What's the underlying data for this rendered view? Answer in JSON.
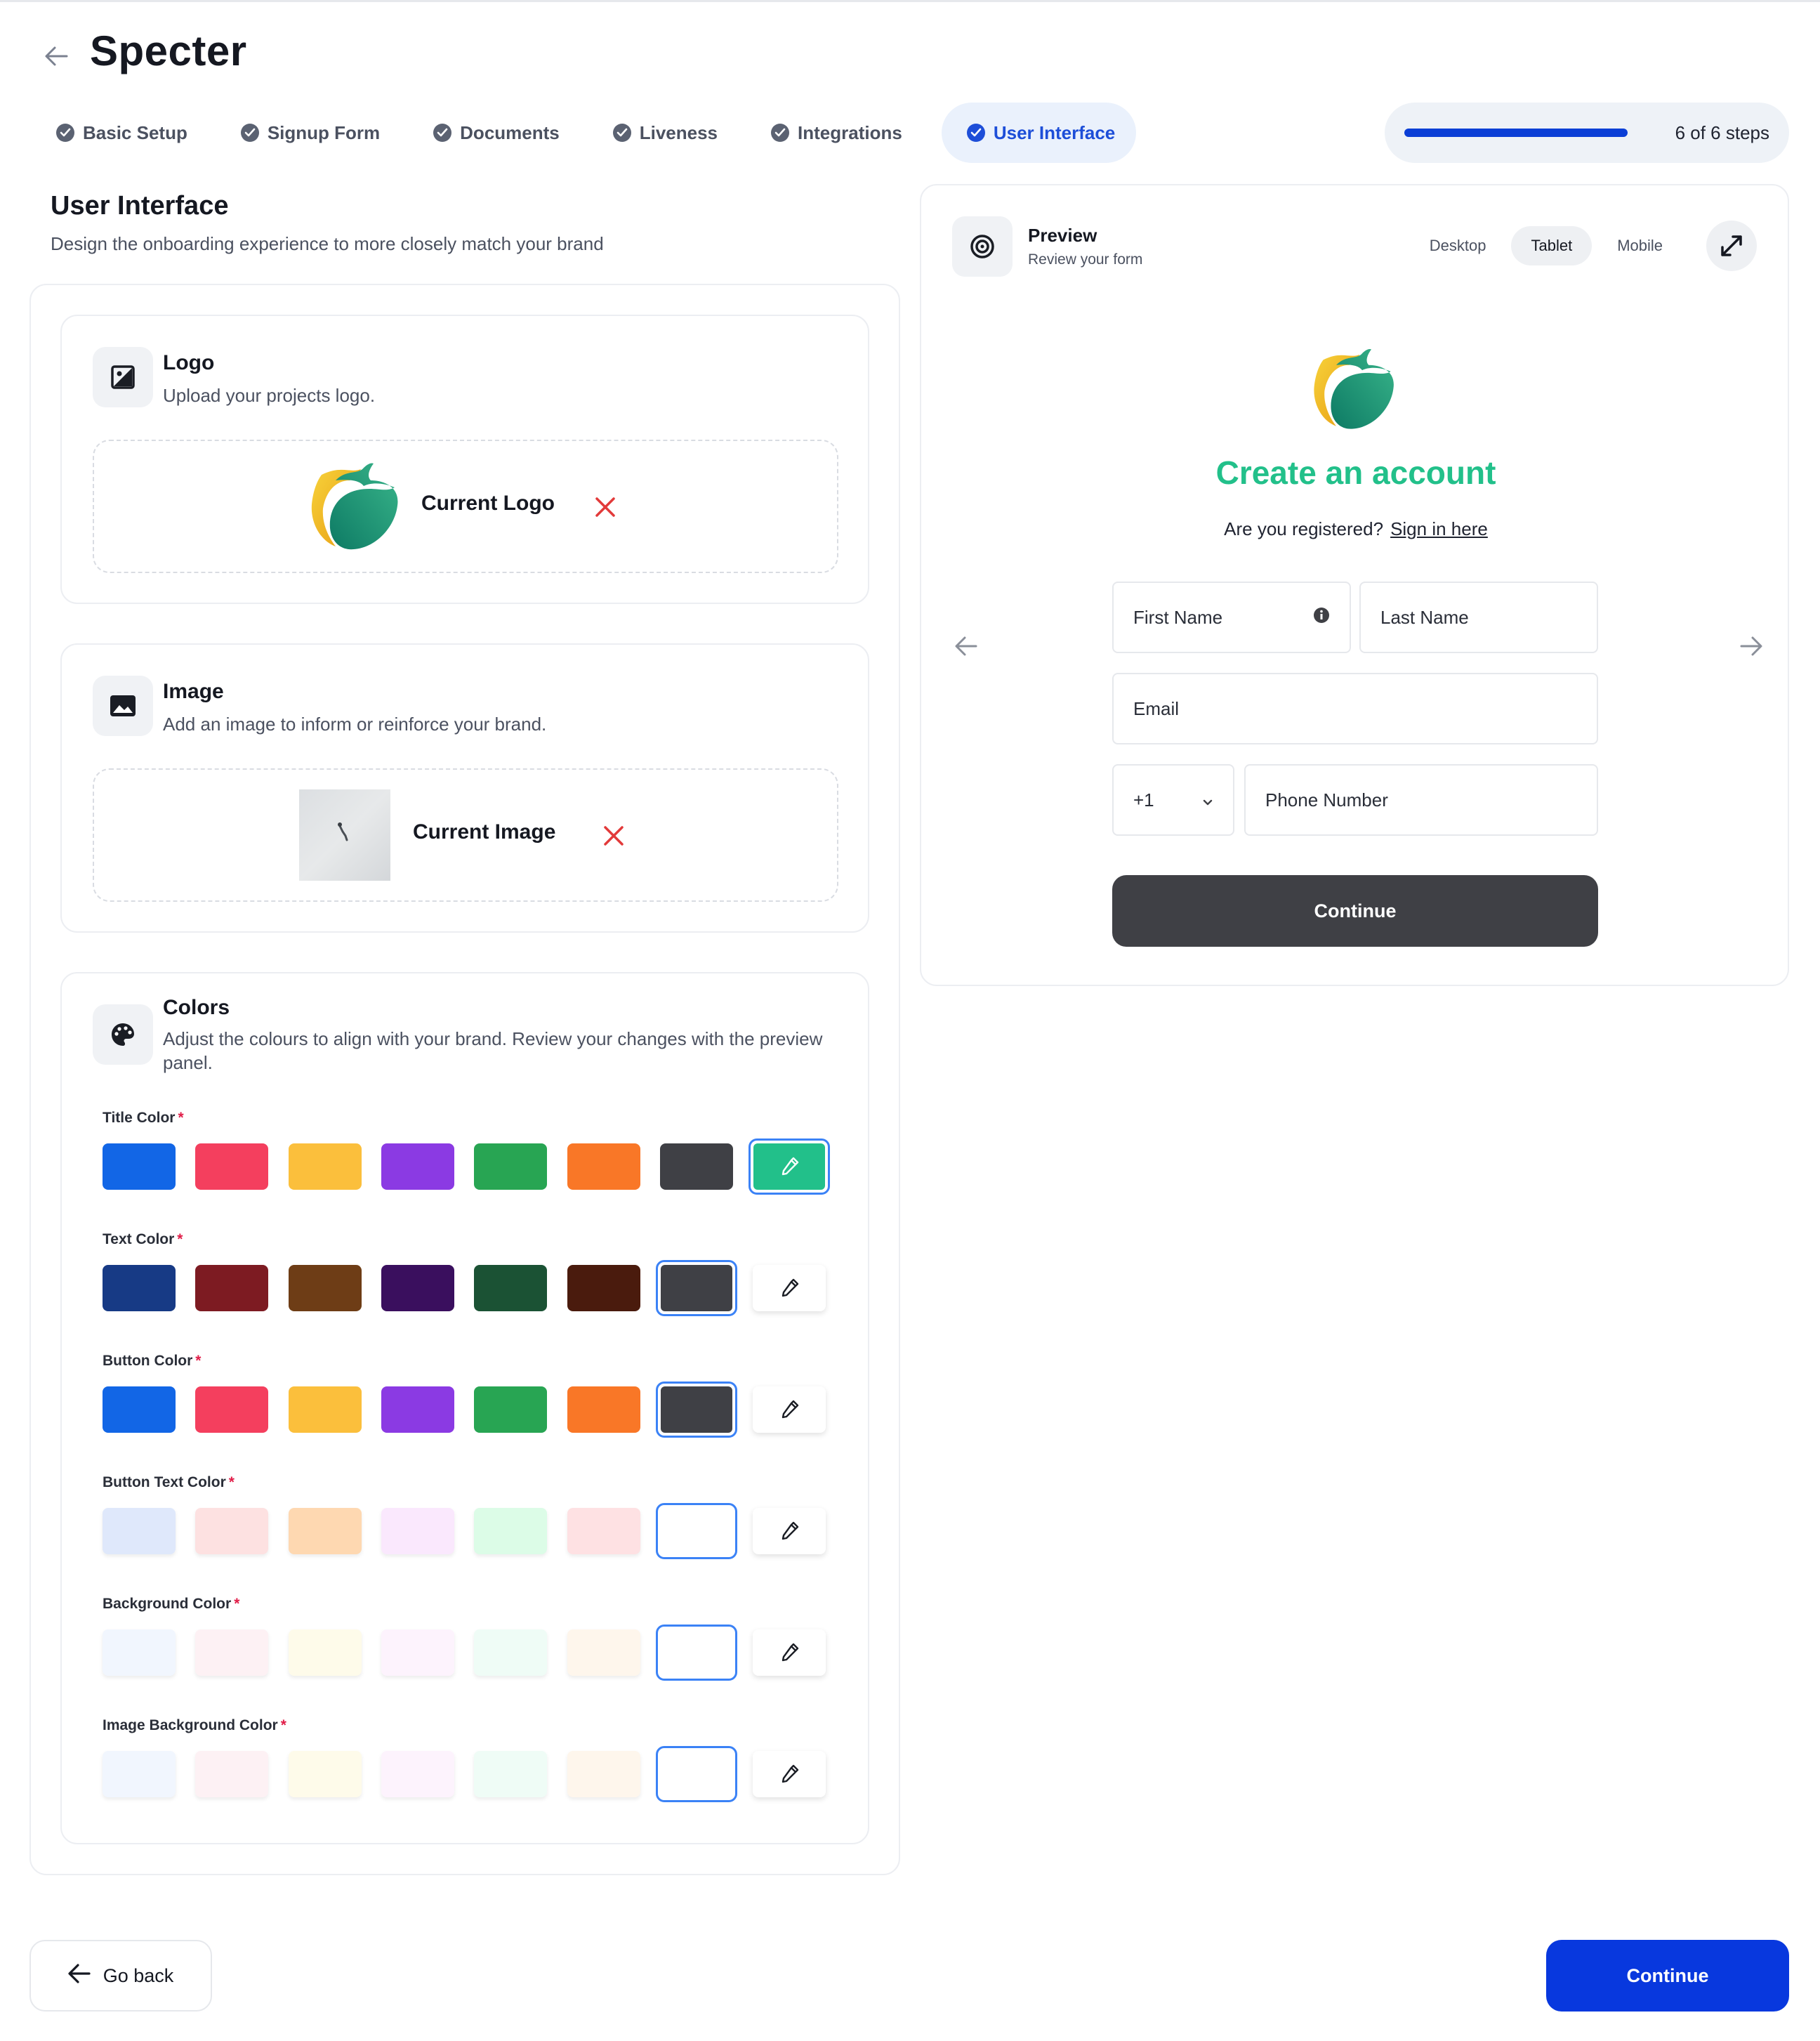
{
  "app": {
    "title": "Specter"
  },
  "steps": [
    {
      "label": "Basic Setup",
      "done": true
    },
    {
      "label": "Signup Form",
      "done": true
    },
    {
      "label": "Documents",
      "done": true
    },
    {
      "label": "Liveness",
      "done": true
    },
    {
      "label": "Integrations",
      "done": true
    },
    {
      "label": "User Interface",
      "done": true,
      "active": true
    }
  ],
  "progress": {
    "text": "6 of 6 steps",
    "fraction": 1.0,
    "color": "#0b3fd6"
  },
  "section": {
    "title": "User Interface",
    "subtitle": "Design the onboarding experience to more closely match your brand"
  },
  "logo_card": {
    "title": "Logo",
    "subtitle": "Upload your projects logo.",
    "current_label": "Current Logo"
  },
  "image_card": {
    "title": "Image",
    "subtitle": "Add an image to inform or reinforce your brand.",
    "current_label": "Current Image"
  },
  "colors_card": {
    "title": "Colors",
    "subtitle": "Adjust the colours to align with your brand. Review your changes with the preview panel.",
    "groups": [
      {
        "label": "Title Color",
        "swatches": [
          "#1266e6",
          "#f43f5e",
          "#fbbf3c",
          "#8b3ae3",
          "#28a553",
          "#f97727",
          "#3f4045"
        ],
        "selected": "picker",
        "picker_color": "#22c08a"
      },
      {
        "label": "Text Color",
        "swatches": [
          "#173a85",
          "#7d1b22",
          "#6e3d16",
          "#3a0f5e",
          "#1b5234",
          "#4a1b0d",
          "#3f4045"
        ],
        "selected": 6
      },
      {
        "label": "Button Color",
        "swatches": [
          "#1266e6",
          "#f43f5e",
          "#fbbf3c",
          "#8b3ae3",
          "#28a553",
          "#f97727",
          "#3f4045"
        ],
        "selected": 6
      },
      {
        "label": "Button Text Color",
        "swatches": [
          "#dfe8fb",
          "#fde1e1",
          "#fed8b1",
          "#fae8fd",
          "#dcfce7",
          "#fee1e3",
          "#ffffff"
        ],
        "selected": 6
      },
      {
        "label": "Background Color",
        "swatches": [
          "#f1f6fe",
          "#fdf1f4",
          "#fefbea",
          "#fdf3fd",
          "#effcf6",
          "#fef6ec",
          "#ffffff"
        ],
        "selected": 6
      },
      {
        "label": "Image Background Color",
        "swatches": [
          "#f1f6fe",
          "#fdf1f4",
          "#fefbea",
          "#fdf3fd",
          "#effcf6",
          "#fef6ec",
          "#ffffff"
        ],
        "selected": 6
      }
    ],
    "required_mark": "*"
  },
  "preview": {
    "title": "Preview",
    "subtitle": "Review your form",
    "device_tabs": [
      "Desktop",
      "Tablet",
      "Mobile"
    ],
    "active_device": "Tablet",
    "form": {
      "heading": "Create an account",
      "heading_color": "#22c08a",
      "question": "Are you registered?",
      "sign_in_link": "Sign in here",
      "first_name_placeholder": "First Name",
      "last_name_placeholder": "Last Name",
      "email_placeholder": "Email",
      "country_code": "+1",
      "phone_placeholder": "Phone Number",
      "continue_label": "Continue",
      "button_color": "#3f4045"
    }
  },
  "footer": {
    "go_back_label": "Go back",
    "continue_label": "Continue",
    "continue_color": "#0838de"
  },
  "icons": {
    "back": "arrow-left-icon",
    "step_done": "check-circle-icon",
    "logo_card": "image-square-icon",
    "image_card": "landscape-image-icon",
    "colors_card": "palette-icon",
    "preview": "target-icon",
    "expand": "expand-arrows-icon",
    "remove": "close-x-icon",
    "picker": "eyedropper-icon",
    "info": "info-icon",
    "chevron": "chevron-down-icon"
  }
}
